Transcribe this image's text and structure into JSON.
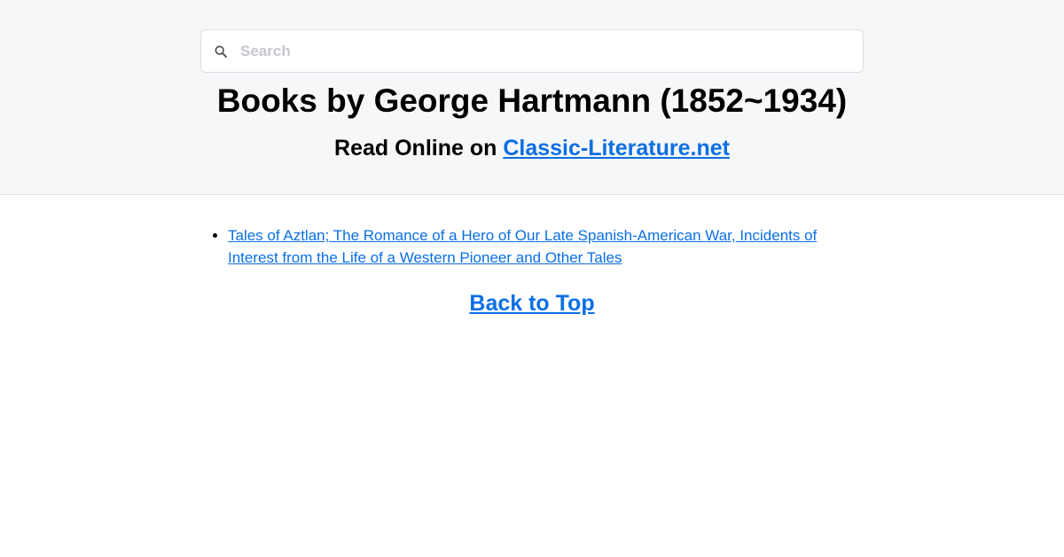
{
  "search": {
    "placeholder": "Search",
    "icon": "search-icon"
  },
  "header": {
    "title": "Books by George Hartmann (1852~1934)",
    "subtitle_prefix": "Read Online on ",
    "site_link": "Classic-Literature.net"
  },
  "books": [
    {
      "title": "Tales of Aztlan; The Romance of a Hero of Our Late Spanish-American War, Incidents of Interest from the Life of a Western Pioneer and Other Tales"
    }
  ],
  "footer": {
    "back_to_top": "Back to Top"
  },
  "colors": {
    "link": "#0b6fe4",
    "header_bg": "#f6f7f9"
  }
}
